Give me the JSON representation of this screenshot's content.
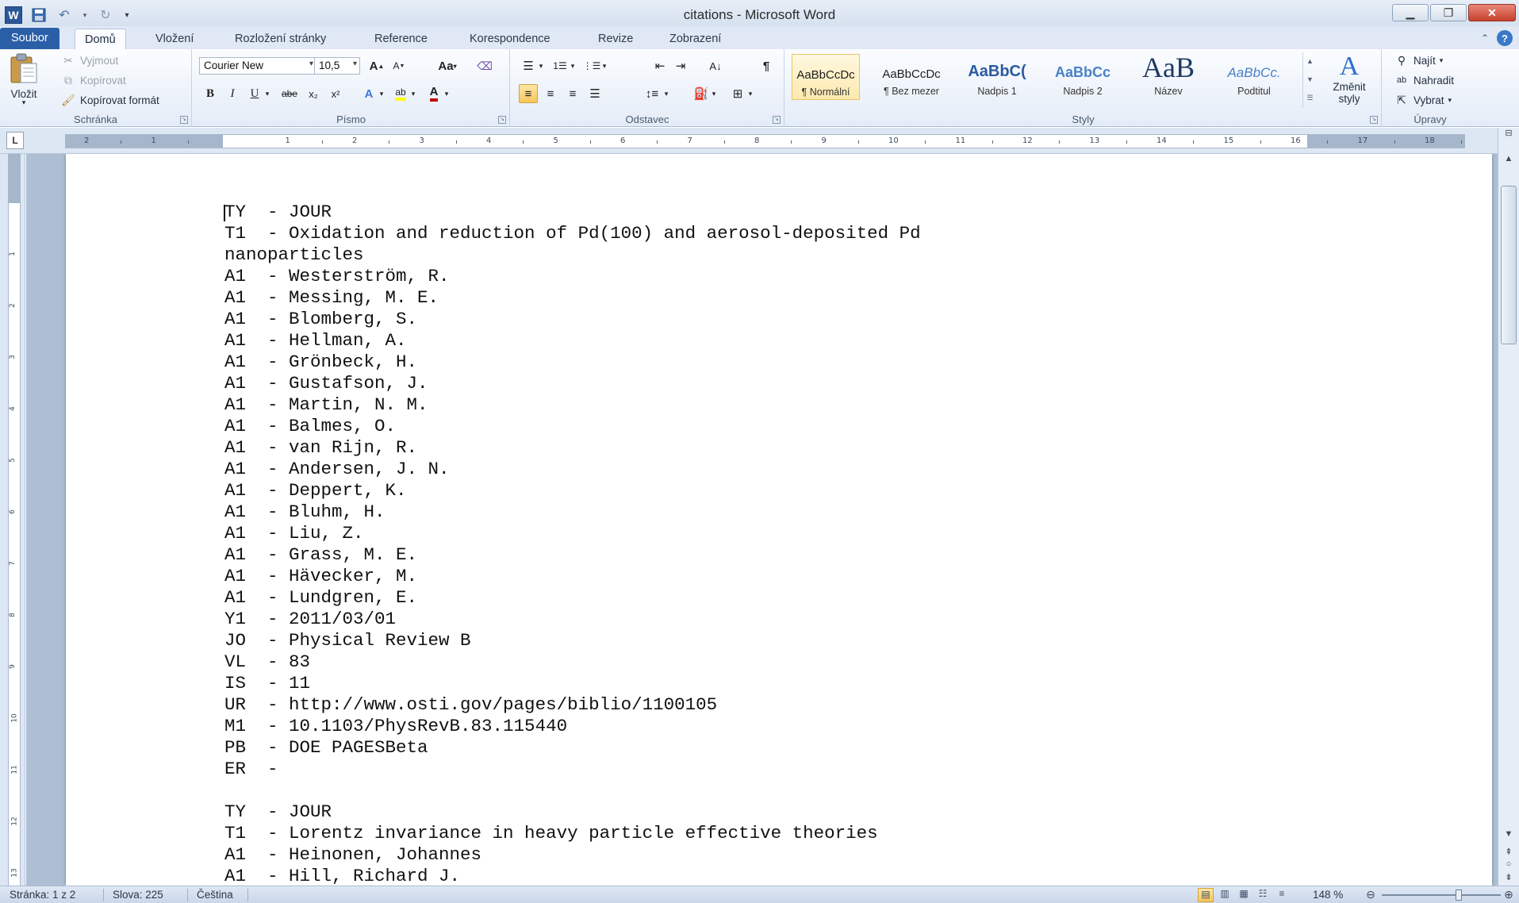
{
  "window": {
    "title": "citations - Microsoft Word"
  },
  "qat": {
    "app_icon": "W"
  },
  "tabs": [
    {
      "label": "Soubor"
    },
    {
      "label": "Domů"
    },
    {
      "label": "Vložení"
    },
    {
      "label": "Rozložení stránky"
    },
    {
      "label": "Reference"
    },
    {
      "label": "Korespondence"
    },
    {
      "label": "Revize"
    },
    {
      "label": "Zobrazení"
    }
  ],
  "clipboard": {
    "paste": "Vložit",
    "cut": "Vyjmout",
    "copy": "Kopírovat",
    "format_painter": "Kopírovat formát",
    "group_label": "Schránka"
  },
  "font": {
    "family": "Courier New",
    "size": "10,5",
    "group_label": "Písmo",
    "grow": "A",
    "shrink": "A",
    "change_case": "Aa",
    "bold": "B",
    "italic": "I",
    "underline": "U",
    "strike": "abe",
    "subscript": "x₂",
    "superscript": "x²"
  },
  "paragraph": {
    "group_label": "Odstavec",
    "pilcrow": "¶"
  },
  "styles": {
    "group_label": "Styly",
    "items": [
      {
        "sample": "AaBbCcDc",
        "name": "¶ Normální"
      },
      {
        "sample": "AaBbCcDc",
        "name": "¶ Bez mezer"
      },
      {
        "sample": "AaBbC(",
        "name": "Nadpis 1"
      },
      {
        "sample": "AaBbCc",
        "name": "Nadpis 2"
      },
      {
        "sample": "AaB",
        "name": "Název"
      },
      {
        "sample": "AaBbCc.",
        "name": "Podtitul"
      }
    ],
    "change_styles": "Změnit styly"
  },
  "editing": {
    "group_label": "Úpravy",
    "find": "Najít",
    "replace": "Nahradit",
    "select": "Vybrat"
  },
  "ruler": {
    "h_ticks": [
      "2",
      "1",
      "1",
      "2",
      "3",
      "4",
      "5",
      "6",
      "7",
      "8",
      "9",
      "10",
      "11",
      "12",
      "13",
      "14",
      "15",
      "16",
      "17",
      "18"
    ],
    "v_ticks": [
      "1",
      "2",
      "3",
      "4",
      "5",
      "6",
      "7",
      "8",
      "9",
      "10",
      "11",
      "12",
      "13"
    ]
  },
  "document": {
    "lines": [
      "TY  - JOUR",
      "T1  - Oxidation and reduction of Pd(100) and aerosol-deposited Pd",
      "nanoparticles",
      "A1  - Westerström, R.",
      "A1  - Messing, M. E.",
      "A1  - Blomberg, S.",
      "A1  - Hellman, A.",
      "A1  - Grönbeck, H.",
      "A1  - Gustafson, J.",
      "A1  - Martin, N. M.",
      "A1  - Balmes, O.",
      "A1  - van Rijn, R.",
      "A1  - Andersen, J. N.",
      "A1  - Deppert, K.",
      "A1  - Bluhm, H.",
      "A1  - Liu, Z.",
      "A1  - Grass, M. E.",
      "A1  - Hävecker, M.",
      "A1  - Lundgren, E.",
      "Y1  - 2011/03/01",
      "JO  - Physical Review B",
      "VL  - 83",
      "IS  - 11",
      "UR  - http://www.osti.gov/pages/biblio/1100105",
      "M1  - 10.1103/PhysRevB.83.115440",
      "PB  - DOE PAGESBeta",
      "ER  - ",
      "",
      "TY  - JOUR",
      "T1  - Lorentz invariance in heavy particle effective theories",
      "A1  - Heinonen, Johannes",
      "A1  - Hill, Richard J."
    ]
  },
  "status": {
    "page": "Stránka: 1 z 2",
    "words": "Slova: 225",
    "language": "Čeština",
    "zoom": "148 %",
    "zoom_fraction": 0.62
  },
  "colors": {
    "file_tab": "#2a5fa8",
    "highlight": "#f7c659",
    "font_color": "#c00000"
  }
}
